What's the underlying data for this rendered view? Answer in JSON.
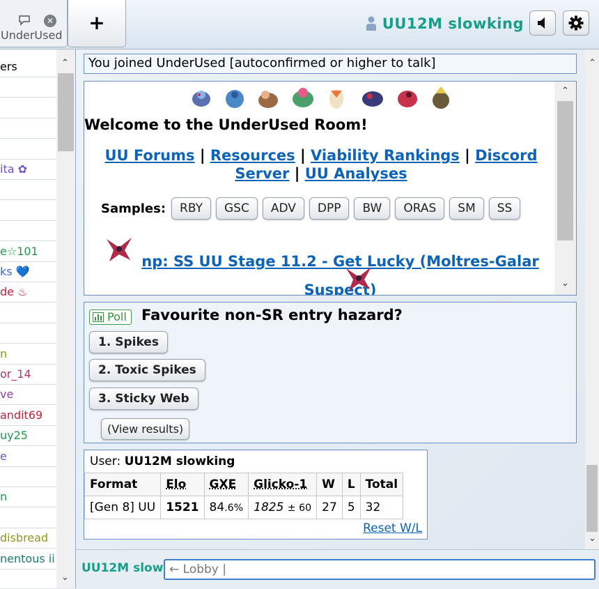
{
  "topbar": {
    "room_tab_label": "UnderUsed",
    "new_tab_label": "+",
    "username": "UU12M slowking"
  },
  "userlist": {
    "items": [
      {
        "text": "ers",
        "color": "#000000"
      },
      {
        "text": "",
        "color": "#000000"
      },
      {
        "text": "",
        "color": "#000000"
      },
      {
        "text": "",
        "color": "#000000"
      },
      {
        "text": "",
        "color": "#000000"
      },
      {
        "text": "ita ✿",
        "color": "#6a57c9"
      },
      {
        "text": "",
        "color": "#000000"
      },
      {
        "text": "",
        "color": "#000000"
      },
      {
        "text": "",
        "color": "#000000"
      },
      {
        "text": "e☆101",
        "color": "#1f9a4a"
      },
      {
        "text": "ks 💙",
        "color": "#3d6bd1"
      },
      {
        "text": "de ♨",
        "color": "#c0233c"
      },
      {
        "text": "",
        "color": "#000000"
      },
      {
        "text": "",
        "color": "#000000"
      },
      {
        "text": "n",
        "color": "#8a9a22"
      },
      {
        "text": "or_14",
        "color": "#b8326a"
      },
      {
        "text": "ve",
        "color": "#9a3bb0"
      },
      {
        "text": "andit69",
        "color": "#c0233c"
      },
      {
        "text": "uy25",
        "color": "#1f9a4a"
      },
      {
        "text": "e",
        "color": "#6a57c9"
      },
      {
        "text": "",
        "color": "#000000"
      },
      {
        "text": "n",
        "color": "#1f9a4a"
      },
      {
        "text": "",
        "color": "#000000"
      },
      {
        "text": "disbread",
        "color": "#8a9a22"
      },
      {
        "text": "nentous ii",
        "color": "#1f7a6a"
      }
    ]
  },
  "chat": {
    "join_message": "You joined UnderUsed [autoconfirmed or higher to talk]",
    "welcome": {
      "title": "Welcome to the UnderUsed Room!",
      "links": [
        "UU Forums",
        "Resources",
        "Viability Rankings",
        "Discord Server",
        "UU Analyses"
      ],
      "separator": "|",
      "samples_label": "Samples:",
      "samples": [
        "RBY",
        "GSC",
        "ADV",
        "DPP",
        "BW",
        "ORAS",
        "SM",
        "SS"
      ],
      "now_playing": "np: SS UU Stage 11.2 - Get Lucky (Moltres-Galar Suspect)"
    },
    "poll": {
      "badge": "Poll",
      "question": "Favourite non-SR entry hazard?",
      "options": [
        "1. Spikes",
        "2. Toxic Spikes",
        "3. Sticky Web"
      ],
      "view_results": "(View results)"
    },
    "stats": {
      "user_label": "User:",
      "user_name": "UU12M slowking",
      "headers": [
        "Format",
        "Elo",
        "GXE",
        "Glicko-1",
        "W",
        "L",
        "Total"
      ],
      "row": {
        "format": "[Gen 8] UU",
        "elo": "1521",
        "gxe_int": "84",
        "gxe_dec": ".6%",
        "glicko": "1825",
        "glicko_dev": "± 60",
        "w": "27",
        "l": "5",
        "total": "32"
      },
      "reset": "Reset W/L"
    }
  },
  "inputbar": {
    "name": "UU12M slow",
    "input_value": "← Lobby |"
  },
  "colors": {
    "username": "#159e88",
    "link": "#0d63b8",
    "poll_green": "#3b8e3b"
  }
}
